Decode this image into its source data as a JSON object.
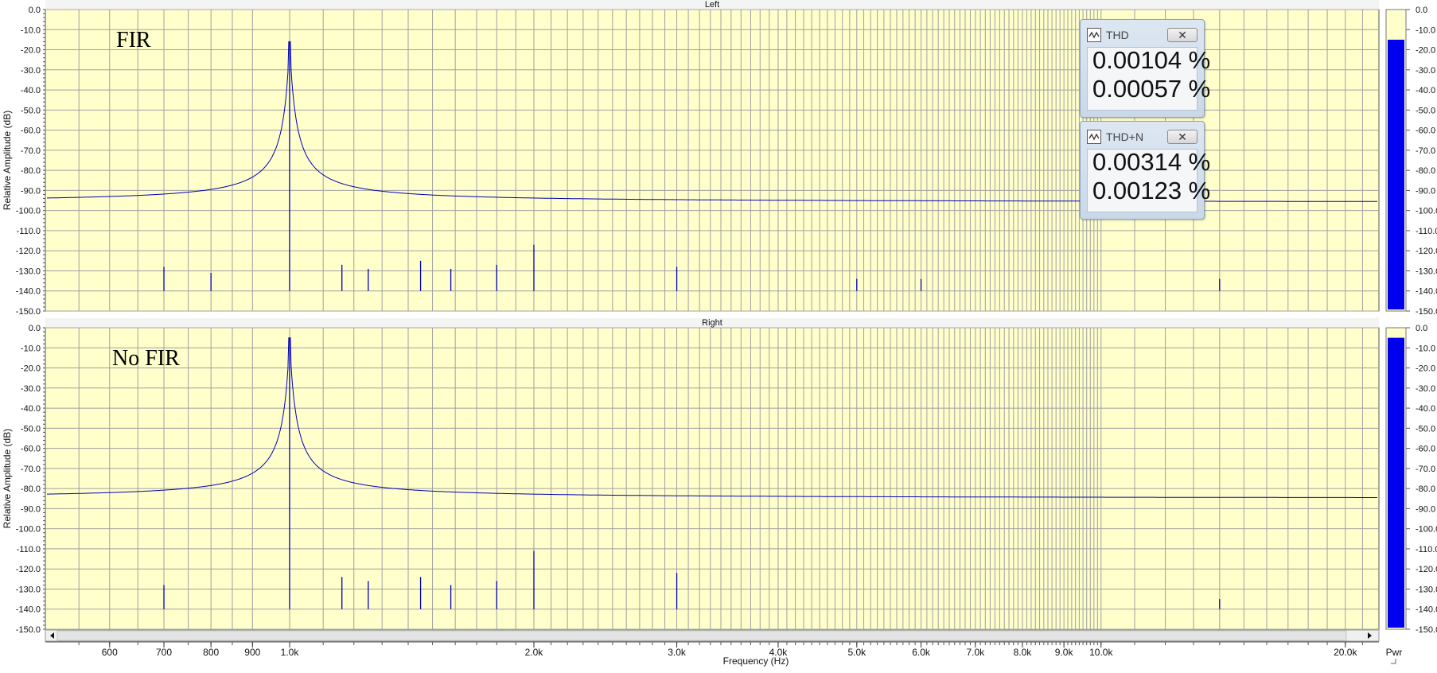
{
  "window": {
    "xlabel": "Frequency (Hz)",
    "pwr_label": "Pwr"
  },
  "meters": [
    {
      "title": "THD",
      "values": [
        "0.00104 %",
        "0.00057 %"
      ],
      "close_icon": "close-icon",
      "icon": "waveform-icon"
    },
    {
      "title": "THD+N",
      "values": [
        "0.00314 %",
        "0.00123 %"
      ],
      "close_icon": "close-icon",
      "icon": "waveform-icon"
    }
  ],
  "colors": {
    "plot_bg": "#ffffcc",
    "trace": "#0000b4",
    "grid": "#a0a0a0",
    "bar": "#0000ee"
  },
  "chart_data": [
    {
      "type": "line",
      "channel": "Left",
      "annotation": "FIR",
      "title": "Left",
      "xlabel": "Frequency (Hz)",
      "ylabel": "Relative Amplitude (dB)",
      "xscale": "log",
      "xlim": [
        500,
        22000
      ],
      "ylim": [
        -150,
        0
      ],
      "yticks": [
        "0.0",
        "-10.0",
        "-20.0",
        "-30.0",
        "-40.0",
        "-50.0",
        "-60.0",
        "-70.0",
        "-80.0",
        "-90.0",
        "-100.0",
        "-110.0",
        "-120.0",
        "-130.0",
        "-140.0",
        "-150.0"
      ],
      "noise_floor_db": -140,
      "peaks": [
        {
          "x": 700,
          "y": -128
        },
        {
          "x": 800,
          "y": -131
        },
        {
          "x": 1000,
          "y": -16
        },
        {
          "x": 1160,
          "y": -127
        },
        {
          "x": 1250,
          "y": -129
        },
        {
          "x": 1450,
          "y": -125
        },
        {
          "x": 1580,
          "y": -129
        },
        {
          "x": 1800,
          "y": -127
        },
        {
          "x": 2000,
          "y": -117
        },
        {
          "x": 3000,
          "y": -128
        },
        {
          "x": 5000,
          "y": -134
        },
        {
          "x": 6000,
          "y": -134
        },
        {
          "x": 14000,
          "y": -134
        }
      ],
      "grid": true,
      "pwr_level_db": -15
    },
    {
      "type": "line",
      "channel": "Right",
      "annotation": "No FIR",
      "title": "Right",
      "xlabel": "Frequency (Hz)",
      "ylabel": "Relative Amplitude (dB)",
      "xscale": "log",
      "xlim": [
        500,
        22000
      ],
      "ylim": [
        -150,
        0
      ],
      "yticks": [
        "0.0",
        "-10.0",
        "-20.0",
        "-30.0",
        "-40.0",
        "-50.0",
        "-60.0",
        "-70.0",
        "-80.0",
        "-90.0",
        "-100.0",
        "-110.0",
        "-120.0",
        "-130.0",
        "-140.0",
        "-150.0"
      ],
      "xticks": [
        "600",
        "700",
        "800",
        "900",
        "1.0k",
        "2.0k",
        "3.0k",
        "4.0k",
        "5.0k",
        "6.0k",
        "7.0k",
        "8.0k",
        "9.0k",
        "10.0k",
        "20.0k"
      ],
      "xtick_values": [
        600,
        700,
        800,
        900,
        1000,
        2000,
        3000,
        4000,
        5000,
        6000,
        7000,
        8000,
        9000,
        10000,
        20000
      ],
      "noise_floor_db": -140,
      "peaks": [
        {
          "x": 700,
          "y": -128
        },
        {
          "x": 1000,
          "y": -5
        },
        {
          "x": 1160,
          "y": -124
        },
        {
          "x": 1250,
          "y": -126
        },
        {
          "x": 1450,
          "y": -124
        },
        {
          "x": 1580,
          "y": -128
        },
        {
          "x": 1800,
          "y": -126
        },
        {
          "x": 2000,
          "y": -111
        },
        {
          "x": 3000,
          "y": -122
        },
        {
          "x": 14000,
          "y": -135
        }
      ],
      "grid": true,
      "pwr_level_db": -5
    }
  ]
}
